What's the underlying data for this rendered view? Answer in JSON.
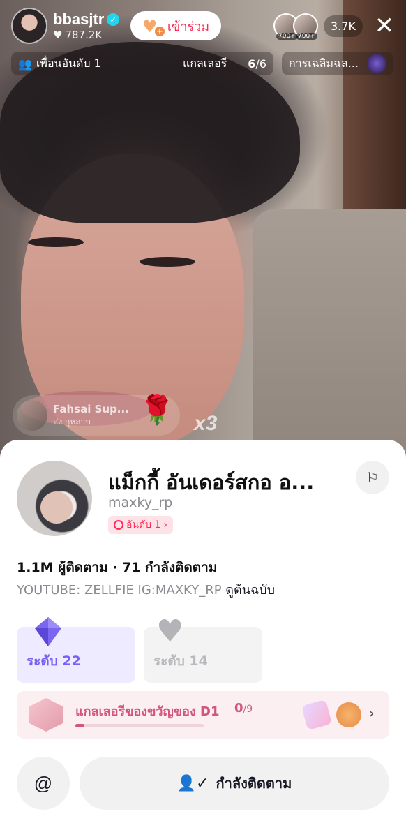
{
  "host": {
    "name": "bbasjtr",
    "likes": "787.2K",
    "join_label": "เข้าร่วม"
  },
  "viewers": {
    "badge_1": "700+",
    "badge_2": "700+",
    "count": "3.7K"
  },
  "chips": {
    "friends": "เพื่อนอันดับ 1",
    "gallery": "แกลเลอรี",
    "gallery_count_done": "6",
    "gallery_count_total": "/6",
    "celebrate": "การเฉลิมฉล..."
  },
  "gift_notice": {
    "sender": "Fahsai Sup...",
    "action": "ส่ง กุหลาบ",
    "combo": "x3"
  },
  "profile": {
    "display_name": "แม็กกี้ อันเดอร์สกอ อ...",
    "username": "maxky_rp",
    "rank": "อันดับ 1",
    "stats": "1.1M ผู้ติดตาม · 71 กำลังติดตาม",
    "bio": "YOUTUBE: ZELLFIE IG:MAXKY_RP ",
    "bio_link": "ดูต้นฉบับ"
  },
  "levels": {
    "level_1": "ระดับ 22",
    "level_2": "ระดับ 14"
  },
  "gallery_card": {
    "title": "แกลเลอรีของขวัญของ D1",
    "collected": "0",
    "total": "/9",
    "progress": 0.07
  },
  "actions": {
    "mention": "@",
    "following": "กำลังติดตาม"
  },
  "colors": {
    "accent": "#fe2c55",
    "level_purple": "#7860f4",
    "gallery_pink": "#d2567a"
  }
}
